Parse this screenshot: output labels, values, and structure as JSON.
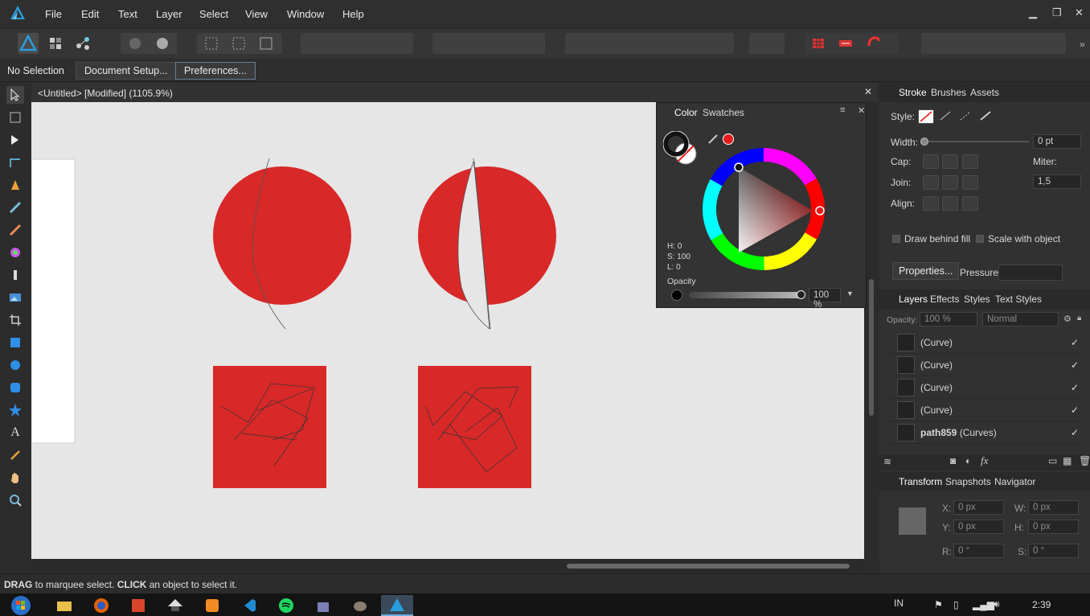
{
  "menu": {
    "items": [
      "File",
      "Edit",
      "Text",
      "Layer",
      "Select",
      "View",
      "Window",
      "Help"
    ]
  },
  "window_controls": {
    "minimize": "▁",
    "restore": "❐",
    "close": "✕"
  },
  "context": {
    "selection": "No Selection",
    "document_setup": "Document Setup...",
    "preferences": "Preferences..."
  },
  "document": {
    "tab_title": "<Untitled> [Modified] (1105.9%)",
    "close": "✕"
  },
  "color_panel": {
    "tabs": [
      "Color",
      "Swatches"
    ],
    "hsl": {
      "h": "H: 0",
      "s": "S: 100",
      "l": "L: 0"
    },
    "opacity_label": "Opacity",
    "opacity_value": "100 %",
    "accent": "#e31b1b"
  },
  "stroke_panel": {
    "tabs": [
      "Stroke",
      "Brushes",
      "Assets"
    ],
    "style_label": "Style:",
    "width_label": "Width:",
    "width_value": "0 pt",
    "cap_label": "Cap:",
    "miter_label": "Miter:",
    "miter_value": "1,5",
    "join_label": "Join:",
    "align_label": "Align:",
    "draw_behind_fill": "Draw behind fill",
    "scale_with_object": "Scale with object",
    "properties": "Properties...",
    "pressure": "Pressure:"
  },
  "layers_panel": {
    "tabs": [
      "Layers",
      "Effects",
      "Styles",
      "Text Styles"
    ],
    "opacity_label": "Opacity:",
    "opacity_value": "100 %",
    "blend_mode": "Normal",
    "rows": [
      {
        "name": "(Curve)",
        "bold": ""
      },
      {
        "name": "(Curve)",
        "bold": ""
      },
      {
        "name": "(Curve)",
        "bold": ""
      },
      {
        "name": "(Curve)",
        "bold": ""
      },
      {
        "name": "(Curves)",
        "bold": "path859"
      }
    ],
    "check": "✓"
  },
  "transform_panel": {
    "tabs": [
      "Transform",
      "Snapshots",
      "Navigator"
    ],
    "x_label": "X:",
    "x_value": "0 px",
    "y_label": "Y:",
    "y_value": "0 px",
    "w_label": "W:",
    "w_value": "0 px",
    "h_label": "H:",
    "h_value": "0 px",
    "r_label": "R:",
    "r_value": "0 °",
    "s_label": "S:",
    "s_value": "0 °"
  },
  "status": {
    "drag": "DRAG",
    "drag_text": " to marquee select. ",
    "click": "CLICK",
    "click_text": " an object to select it."
  },
  "taskbar": {
    "lang": "IN",
    "time": "2:39"
  },
  "canvas_fill": "#d82828"
}
